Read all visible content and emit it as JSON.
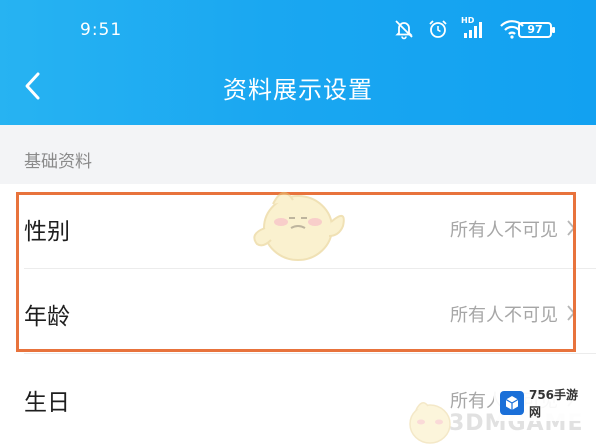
{
  "status_bar": {
    "time": "9:51",
    "signal_label": "HD",
    "battery": "97",
    "icons": [
      "bell-off-icon",
      "alarm-icon",
      "signal-icon",
      "wifi-icon",
      "battery-icon"
    ]
  },
  "header": {
    "title": "资料展示设置",
    "back_icon": "chevron-left-icon"
  },
  "section": {
    "title": "基础资料",
    "items": [
      {
        "label": "性别",
        "value": "所有人不可见"
      },
      {
        "label": "年龄",
        "value": "所有人不可见"
      },
      {
        "label": "生日",
        "value": "所有人不可见"
      }
    ]
  },
  "watermark": {
    "brand": "3DMGAME",
    "badge_text": "756手游网"
  },
  "colors": {
    "header_blue": "#1aa7f1",
    "highlight": "#e8733c",
    "value_gray": "#a6a6a6"
  }
}
